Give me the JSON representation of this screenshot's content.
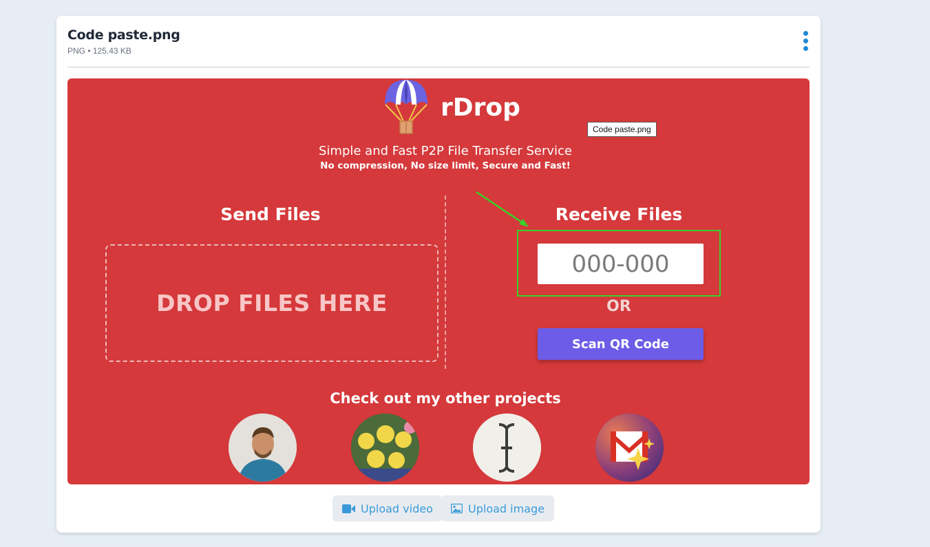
{
  "file": {
    "name": "Code paste.png",
    "meta": "PNG • 125.43 KB"
  },
  "preview": {
    "brand": "rDrop",
    "tooltip": "Code paste.png",
    "tagline": "Simple and Fast P2P File Transfer Service",
    "subtagline": "No compression, No size limit, Secure and Fast!",
    "send_heading": "Send Files",
    "drop_label": "DROP FILES HERE",
    "receive_heading": "Receive Files",
    "code_placeholder": "000-000",
    "or_label": "OR",
    "scan_label": "Scan QR Code",
    "projects_heading": "Check out my other projects",
    "colors": {
      "background": "#d5393b",
      "scan_button": "#6c5ce7",
      "highlight": "#37d22a",
      "arrow": "#37d22a"
    }
  },
  "actions": {
    "upload_video": "Upload video",
    "upload_image": "Upload image"
  },
  "icons": [
    "kebab-menu-icon",
    "parachute-logo-icon",
    "video-camera-icon",
    "image-icon"
  ]
}
